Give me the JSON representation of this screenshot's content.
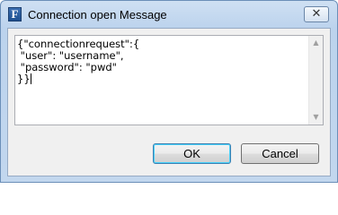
{
  "window": {
    "title": "Connection open Message",
    "icon_letter": "F",
    "close_symbol": "✕"
  },
  "editor": {
    "lines": [
      "{\"connectionrequest\":{",
      " \"user\": \"username\",",
      " \"password\": \"pwd\"",
      "}}"
    ]
  },
  "scrollbar": {
    "up_arrow": "▲",
    "down_arrow": "▼"
  },
  "buttons": {
    "ok_label": "OK",
    "cancel_label": "Cancel"
  }
}
